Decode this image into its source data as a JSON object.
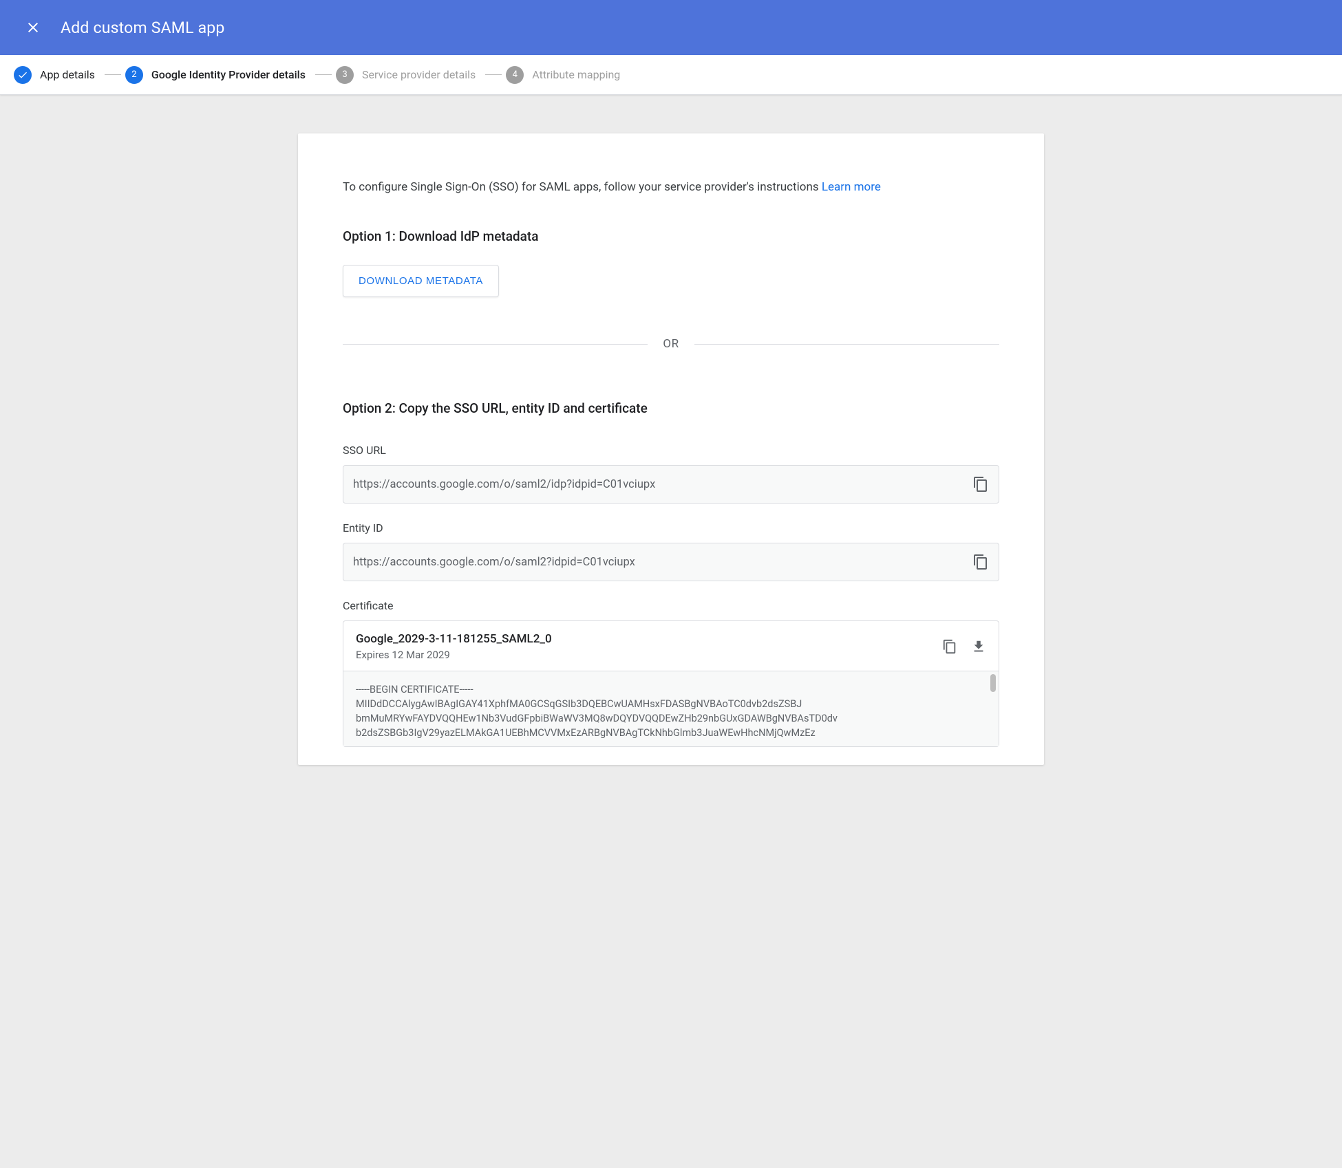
{
  "header": {
    "title": "Add custom SAML app"
  },
  "stepper": {
    "steps": [
      {
        "label": "App details",
        "state": "done"
      },
      {
        "label": "Google Identity Provider details",
        "state": "active",
        "number": "2"
      },
      {
        "label": "Service provider details",
        "state": "pending",
        "number": "3"
      },
      {
        "label": "Attribute mapping",
        "state": "pending",
        "number": "4"
      }
    ]
  },
  "card": {
    "intro_text": "To configure Single Sign-On (SSO) for SAML apps, follow your service provider's instructions ",
    "learn_more": "Learn more",
    "option1_title": "Option 1: Download IdP metadata",
    "download_button": "DOWNLOAD METADATA",
    "or_label": "OR",
    "option2_title": "Option 2: Copy the SSO URL, entity ID and certificate",
    "sso_label": "SSO URL",
    "sso_value": "https://accounts.google.com/o/saml2/idp?idpid=C01vciupx",
    "entity_label": "Entity ID",
    "entity_value": "https://accounts.google.com/o/saml2?idpid=C01vciupx",
    "cert_label": "Certificate",
    "cert_name": "Google_2029-3-11-181255_SAML2_0",
    "cert_expires": "Expires 12 Mar 2029",
    "cert_body": "-----BEGIN CERTIFICATE-----\nMIIDdDCCAlygAwIBAgIGAY41XphfMA0GCSqGSIb3DQEBCwUAMHsxFDASBgNVBAoTC0dvb2dsZSBJ\nbmMuMRYwFAYDVQQHEw1Nb3VudGFpbiBWaWV3MQ8wDQYDVQQDEwZHb29nbGUxGDAWBgNVBAsTD0dv\nb2dsZSBGb3IgV29yazELMAkGA1UEBhMCVVMxEzARBgNVBAgTCkNhbGlmb3JuaWEwHhcNMjQwMzEz"
  }
}
